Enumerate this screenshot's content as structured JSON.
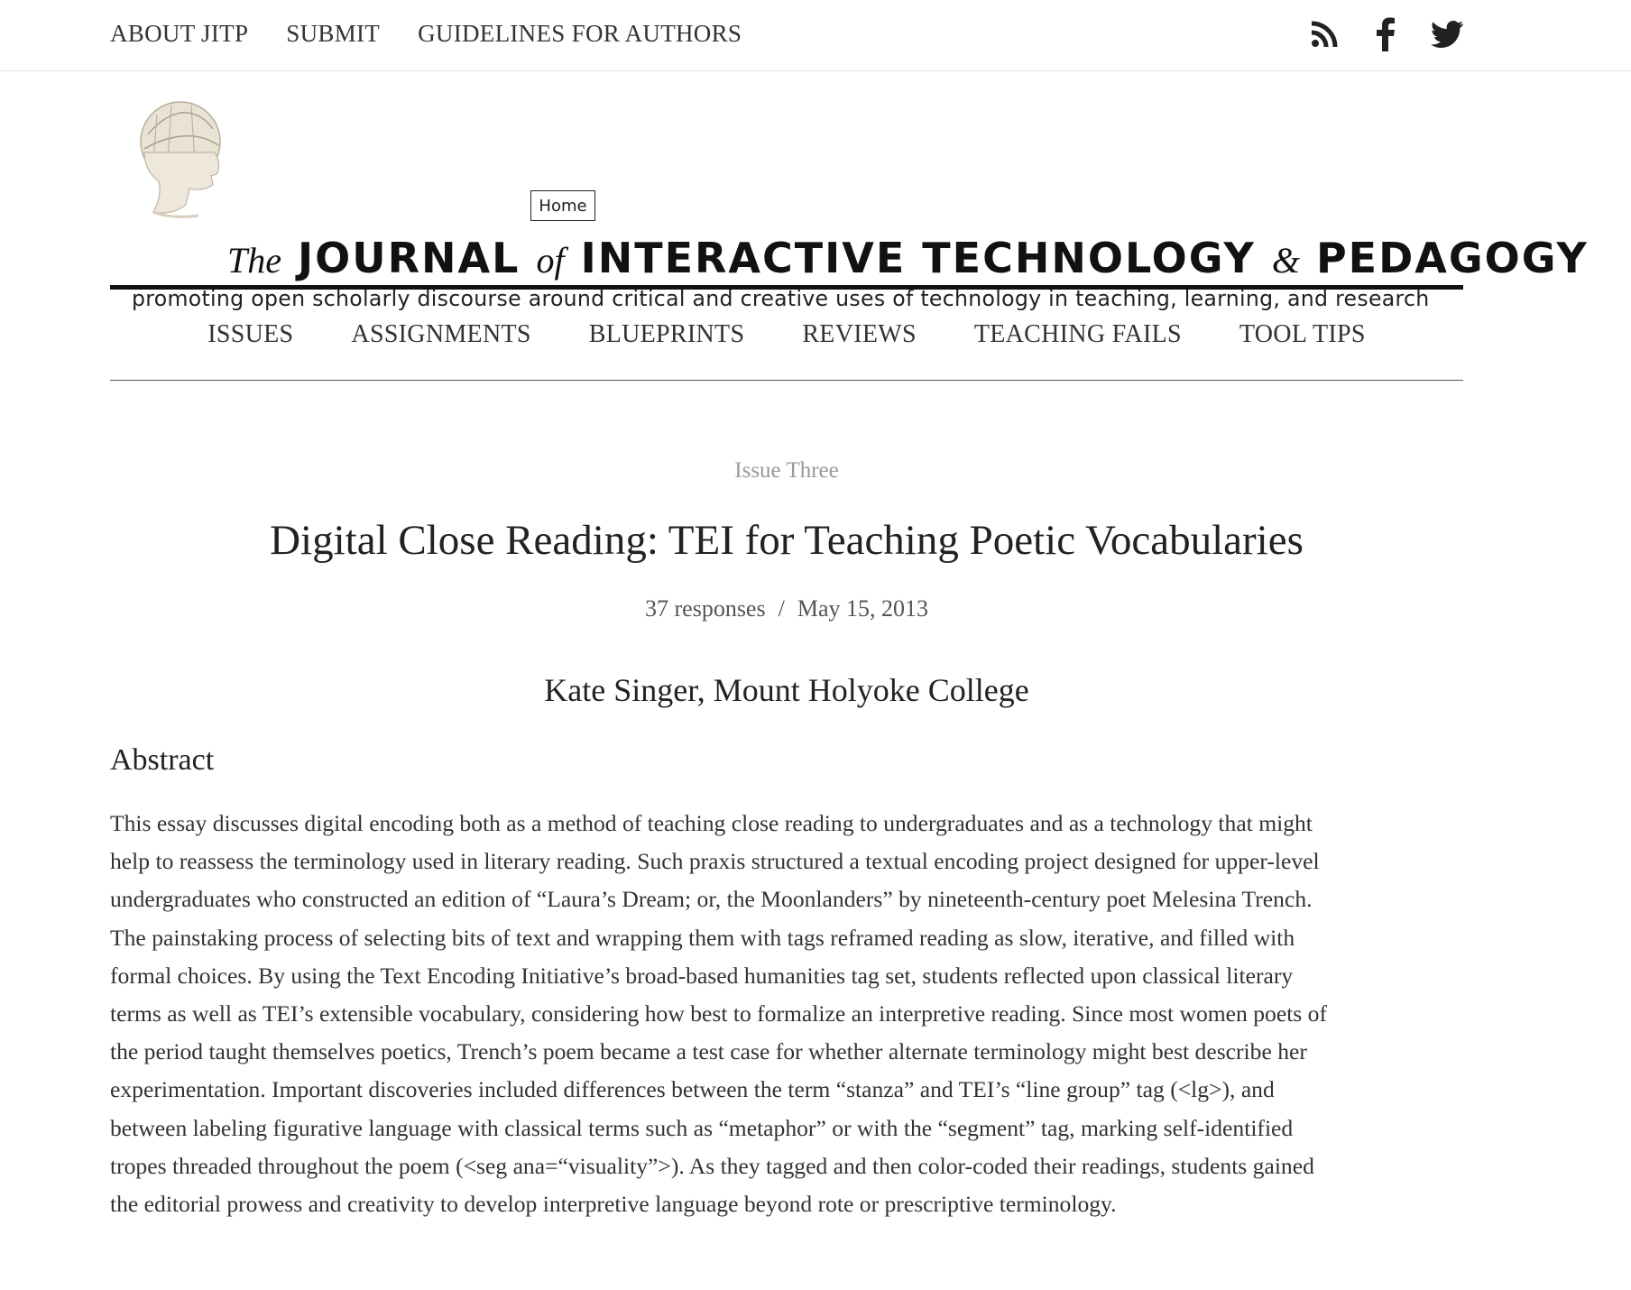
{
  "topnav": {
    "items": [
      "ABOUT JITP",
      "SUBMIT",
      "GUIDELINES FOR AUTHORS"
    ]
  },
  "social": {
    "icons": [
      "rss-icon",
      "facebook-icon",
      "twitter-icon"
    ]
  },
  "masthead": {
    "home_button": "Home",
    "title_the": "The",
    "title_journal": "JOURNAL",
    "title_of": "of",
    "title_main": "INTERACTIVE TECHNOLOGY",
    "title_amp": "&",
    "title_pedagogy": "PEDAGOGY",
    "tagline": "promoting open scholarly discourse around critical and creative uses of technology in teaching, learning, and research"
  },
  "mainnav": {
    "items": [
      "ISSUES",
      "ASSIGNMENTS",
      "BLUEPRINTS",
      "REVIEWS",
      "TEACHING FAILS",
      "TOOL TIPS"
    ]
  },
  "article": {
    "issue": "Issue Three",
    "title": "Digital Close Reading: TEI for Teaching Poetic Vocabularies",
    "responses": "37 responses",
    "separator": "/",
    "date": "May 15, 2013",
    "author": "Kate Singer, Mount Holyoke College",
    "abstract_heading": "Abstract",
    "abstract_lines": [
      "This essay discusses digital encoding both as a method of teaching close reading to undergraduates and as a technology that might",
      "help to reassess the terminology used in literary reading. Such praxis structured a textual encoding project designed for upper-level",
      "undergraduates who constructed an edition of “Laura’s Dream; or, the Moonlanders” by nineteenth-century poet Melesina Trench.",
      "The painstaking process of selecting bits of text and wrapping them with tags reframed reading as slow, iterative, and filled with",
      "formal choices. By using the Text Encoding Initiative’s broad-based humanities tag set, students reflected upon classical literary",
      "terms as well as TEI’s extensible vocabulary, considering how best to formalize an interpretive reading. Since most women poets of",
      "the period taught themselves poetics, Trench’s poem became a test case for whether alternate terminology might best describe her",
      "experimentation. Important discoveries included differences between the term “stanza” and TEI’s “line group” tag (<lg>), and",
      "between labeling figurative language with classical terms such as “metaphor” or with the “segment” tag, marking self-identified",
      "tropes threaded throughout the poem (<seg ana=“visuality”>). As they tagged and then color-coded their readings, students gained",
      "the editorial prowess and creativity to develop interpretive language beyond rote or prescriptive terminology."
    ]
  }
}
